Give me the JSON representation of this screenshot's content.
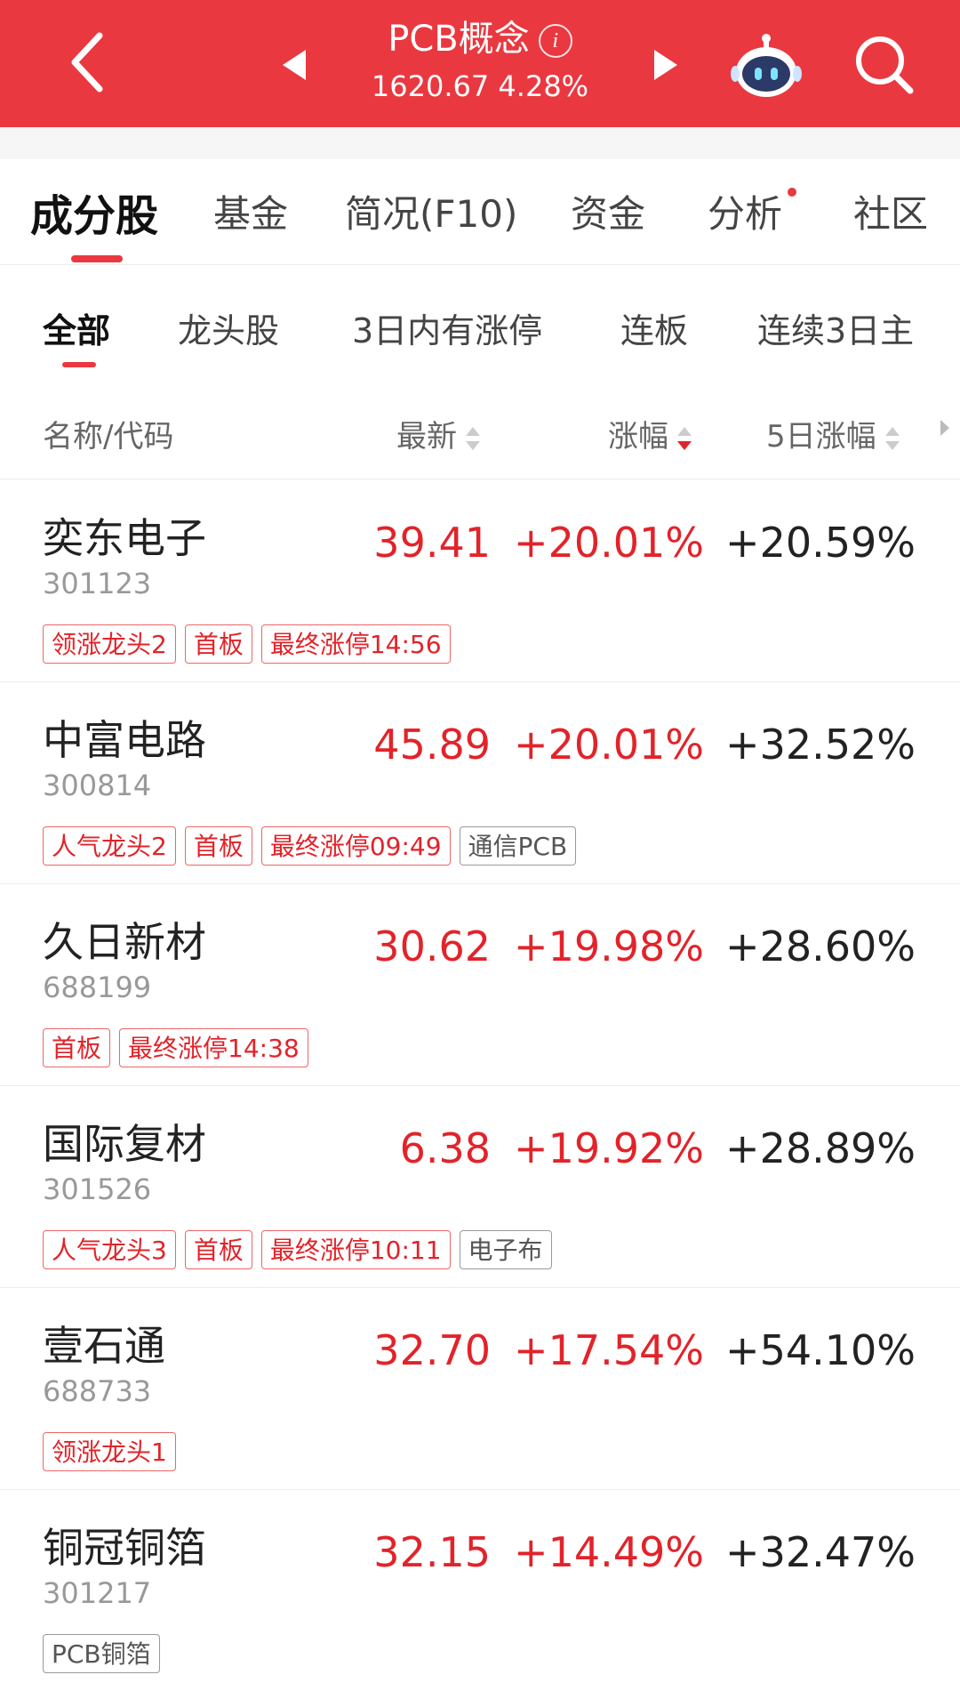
{
  "header": {
    "title": "PCB概念",
    "price": "1620.67",
    "change": "4.28%",
    "info_glyph": "i",
    "icons": [
      "back-icon",
      "prev-arrow-icon",
      "next-arrow-icon",
      "info-icon",
      "robot-assistant-icon",
      "search-icon"
    ],
    "bg_color": "#ea3840"
  },
  "main_tabs": [
    {
      "label": "成分股",
      "active": true
    },
    {
      "label": "基金"
    },
    {
      "label": "简况(F10)"
    },
    {
      "label": "资金"
    },
    {
      "label": "分析",
      "dot": true
    },
    {
      "label": "社区"
    }
  ],
  "sub_tabs": [
    {
      "label": "全部",
      "active": true
    },
    {
      "label": "龙头股"
    },
    {
      "label": "3日内有涨停"
    },
    {
      "label": "连板"
    },
    {
      "label": "连续3日主"
    }
  ],
  "columns": {
    "name": "名称/代码",
    "price": "最新",
    "change": "涨幅",
    "change5": "5日涨幅"
  },
  "rows": [
    {
      "name": "奕东电子",
      "code": "301123",
      "price": "39.41",
      "change": "+20.01%",
      "change5": "+20.59%",
      "tags": [
        {
          "text": "领涨龙头2"
        },
        {
          "text": "首板"
        },
        {
          "text": "最终涨停14:56"
        }
      ]
    },
    {
      "name": "中富电路",
      "code": "300814",
      "price": "45.89",
      "change": "+20.01%",
      "change5": "+32.52%",
      "tags": [
        {
          "text": "人气龙头2"
        },
        {
          "text": "首板"
        },
        {
          "text": "最终涨停09:49"
        },
        {
          "text": "通信PCB",
          "gray": true
        }
      ]
    },
    {
      "name": "久日新材",
      "code": "688199",
      "price": "30.62",
      "change": "+19.98%",
      "change5": "+28.60%",
      "tags": [
        {
          "text": "首板"
        },
        {
          "text": "最终涨停14:38"
        }
      ]
    },
    {
      "name": "国际复材",
      "code": "301526",
      "price": "6.38",
      "change": "+19.92%",
      "change5": "+28.89%",
      "tags": [
        {
          "text": "人气龙头3"
        },
        {
          "text": "首板"
        },
        {
          "text": "最终涨停10:11"
        },
        {
          "text": "电子布",
          "gray": true
        }
      ]
    },
    {
      "name": "壹石通",
      "code": "688733",
      "price": "32.70",
      "change": "+17.54%",
      "change5": "+54.10%",
      "tags": [
        {
          "text": "领涨龙头1"
        }
      ]
    },
    {
      "name": "铜冠铜箔",
      "code": "301217",
      "price": "32.15",
      "change": "+14.49%",
      "change5": "+32.47%",
      "tags": [
        {
          "text": "PCB铜箔",
          "gray": true
        }
      ]
    }
  ],
  "colors": {
    "up": "#e2232a",
    "tag_red": "#e66",
    "tag_gray": "#999"
  }
}
